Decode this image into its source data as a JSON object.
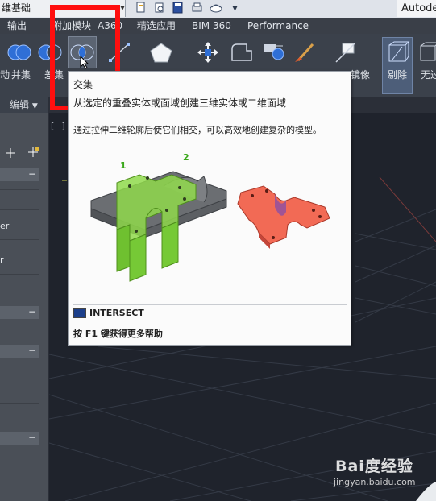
{
  "titlebar": {
    "workspace": "维基础",
    "app_title": "Autode",
    "qat_icons": [
      "new-icon",
      "open-icon",
      "save-icon",
      "plot-icon",
      "share-icon",
      "dropdown-icon"
    ]
  },
  "tabs": [
    "输出",
    "附加模块",
    "A360",
    "精选应用",
    "BIM 360",
    "Performance"
  ],
  "ribbon": {
    "union_label": "并集",
    "subtract_label": "差集",
    "left_fragment": "动",
    "mirror_fragment": "镜像",
    "erase_label": "剔除",
    "nofilter_fragment": "无过",
    "panel_title": "编辑",
    "panel_dropdown": "▼"
  },
  "palette": {
    "collapse": "−",
    "row1": "er",
    "row2": "r"
  },
  "viewport": {
    "label": "[−]"
  },
  "tooltip": {
    "title": "交集",
    "description": "从选定的重叠实体或面域创建三维实体或二维面域",
    "detail": "通过拉伸二维轮廓后使它们相交，可以高效地创建复杂的模型。",
    "callout_1": "1",
    "callout_2": "2",
    "command": "INTERSECT",
    "help": "按 F1 键获得更多帮助"
  },
  "watermark": {
    "logo": "Bai度经验",
    "url": "jingyan.baidu.com"
  },
  "colors": {
    "annotation_red": "#ff0f0f",
    "ribbon_bg": "#3b414b",
    "viewport_bg": "#1f232c",
    "green_solid": "#8fd94b",
    "red_result": "#f26a55"
  }
}
